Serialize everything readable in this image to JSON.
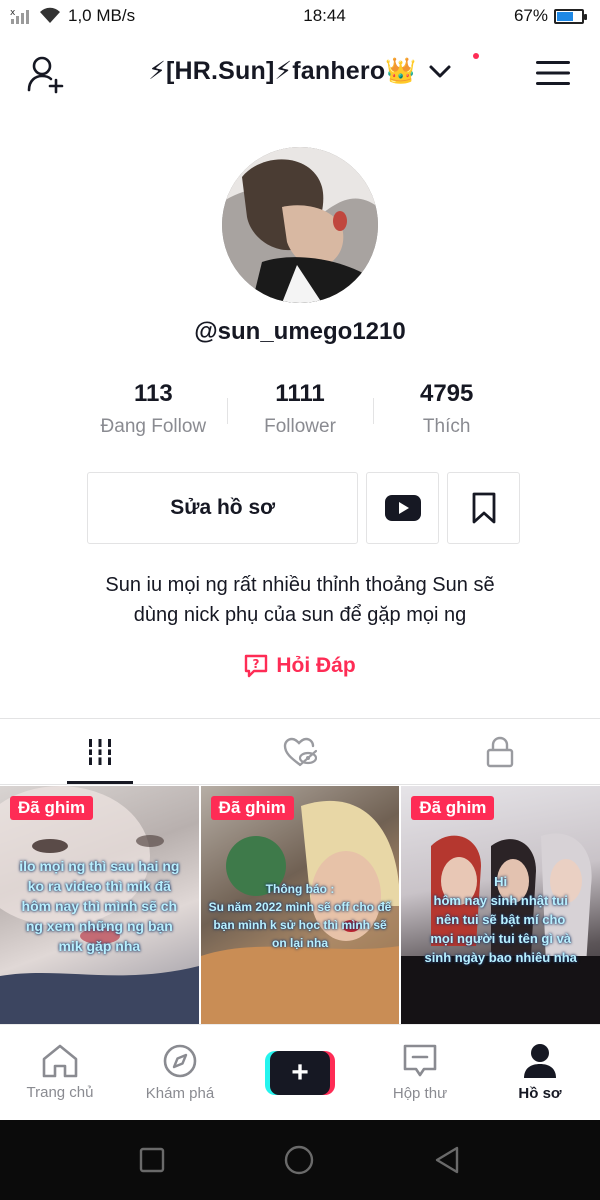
{
  "status_bar": {
    "network_speed": "1,0 MB/s",
    "time": "18:44",
    "battery_percent": "67%",
    "battery_level": 0.67
  },
  "header": {
    "title": "⚡[HR.Sun]⚡fanhero👑"
  },
  "profile": {
    "username": "@sun_umego1210",
    "stats": [
      {
        "value": "113",
        "label": "Đang Follow"
      },
      {
        "value": "1111",
        "label": "Follower"
      },
      {
        "value": "4795",
        "label": "Thích"
      }
    ],
    "edit_button": "Sửa hồ sơ",
    "bio_line1": "Sun iu mọi ng rất nhiều thỉnh thoảng Sun sẽ",
    "bio_line2": "dùng nick phụ của sun để gặp mọi ng",
    "qa_label": "Hỏi Đáp"
  },
  "videos": [
    {
      "badge": "Đã ghim",
      "caption": [
        "ilo mọi ng thì sau hai ng",
        "ko ra video thì mik đã",
        "hôm nay thì mình sẽ ch",
        "ng xem những ng bạn",
        "mik gặp nha"
      ]
    },
    {
      "badge": "Đã ghim",
      "caption": [
        "Thông báo :",
        "Su năm 2022 mình sẽ off cho đế",
        "bạn mình k sử học thì mình sẽ",
        "on lại nha"
      ]
    },
    {
      "badge": "Đã ghim",
      "caption": [
        "Hi",
        "hôm nay sinh nhật tui",
        "nên tui sẽ bật mí cho",
        "mọi người tui tên gì và",
        "sinh ngày bao nhiêu nha"
      ]
    }
  ],
  "bottom_nav": {
    "home": "Trang chủ",
    "discover": "Khám phá",
    "inbox": "Hộp thư",
    "profile": "Hồ sơ"
  },
  "colors": {
    "accent": "#fe2c55",
    "teal": "#25f4ee",
    "text": "#161823",
    "muted": "#8a8b91"
  }
}
